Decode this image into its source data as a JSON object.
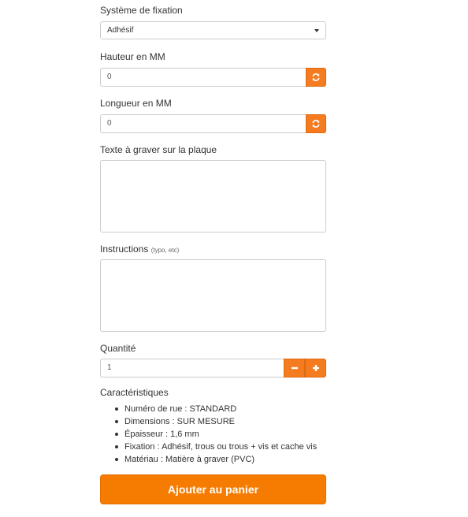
{
  "fixation": {
    "label": "Système de fixation",
    "selected": "Adhésif"
  },
  "height": {
    "label": "Hauteur en MM",
    "value": "0"
  },
  "length": {
    "label": "Longueur en MM",
    "value": "0"
  },
  "engraving": {
    "label": "Texte à graver sur la plaque",
    "value": ""
  },
  "instructions": {
    "label": "Instructions",
    "hint": "(typo, etc)",
    "value": ""
  },
  "quantity": {
    "label": "Quantité",
    "value": "1",
    "minus": "−",
    "plus": "+"
  },
  "characteristics": {
    "title": "Caractéristiques",
    "items": [
      "Numéro de rue : STANDARD",
      "Dimensions : SUR MESURE",
      "Épaisseur : 1,6 mm",
      "Fixation : Adhésif, trous ou trous + vis et cache vis",
      "Matériau : Matière à graver (PVC)"
    ]
  },
  "cart_button": {
    "label": "Ajouter au panier"
  },
  "colors": {
    "accent": "#f47b20",
    "border": "#cccccc",
    "text": "#333333"
  },
  "icons": {
    "refresh": "refresh-icon",
    "caret": "chevron-down-icon"
  }
}
